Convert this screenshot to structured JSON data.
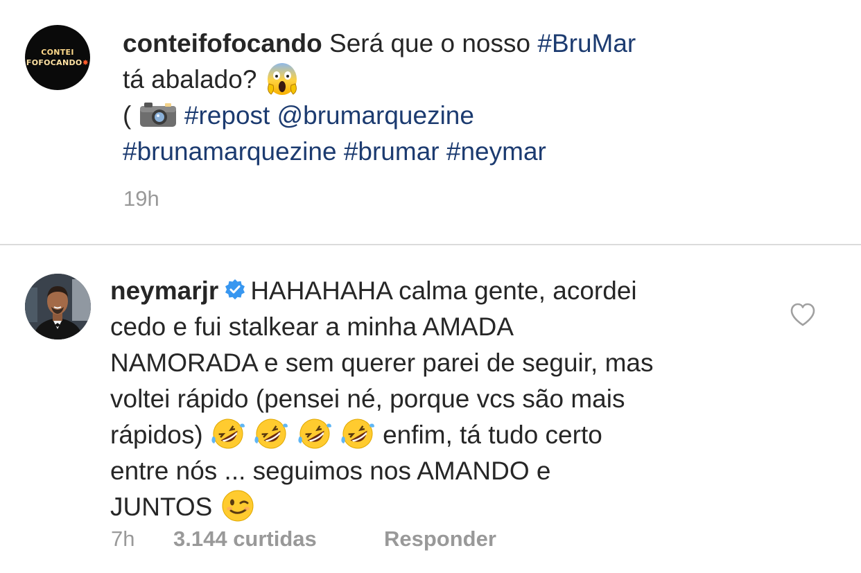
{
  "post": {
    "avatar_line1": "CONTEI",
    "avatar_line2": "FOFOCANDO",
    "username": "conteifofocando",
    "text_part1": "Será que o nosso",
    "hashtag_brumar_caps": "#BruMar",
    "line2_text": "tá abalado?",
    "paren_open": "(",
    "hashtag_repost": "#repost",
    "mention": "@brumarquezine",
    "hashtag_brunamarquezine": "#brunamarquezine",
    "hashtag_brumar": "#brumar",
    "hashtag_neymar": "#neymar",
    "time": "19h",
    "emoji_scream": "scream-emoji",
    "emoji_camera": "camera-emoji"
  },
  "comment": {
    "username": "neymarjr",
    "verified_icon": "verified-badge-icon",
    "line1": "HAHAHAHA calma gente, acordei",
    "line2": "cedo e fui stalkear a minha AMADA",
    "line3": "NAMORADA e sem querer parei de seguir, mas",
    "line4": "voltei rápido (pensei né, porque vcs são mais",
    "line5_start": "rápidos)",
    "line5_end": "enfim, tá tudo certo",
    "line6": "entre nós ... seguimos nos AMANDO e",
    "line7": "JUNTOS",
    "emoji_laugh": "rolling-on-floor-laughing-emoji",
    "emoji_wink": "winking-face-emoji",
    "time": "7h",
    "likes": "3.144 curtidas",
    "reply_label": "Responder",
    "heart_icon": "heart-outline-icon"
  },
  "colors": {
    "text": "#262626",
    "hashtag": "#1c3b70",
    "meta": "#999999",
    "divider": "#dbdbdb",
    "verified": "#3897f0"
  }
}
